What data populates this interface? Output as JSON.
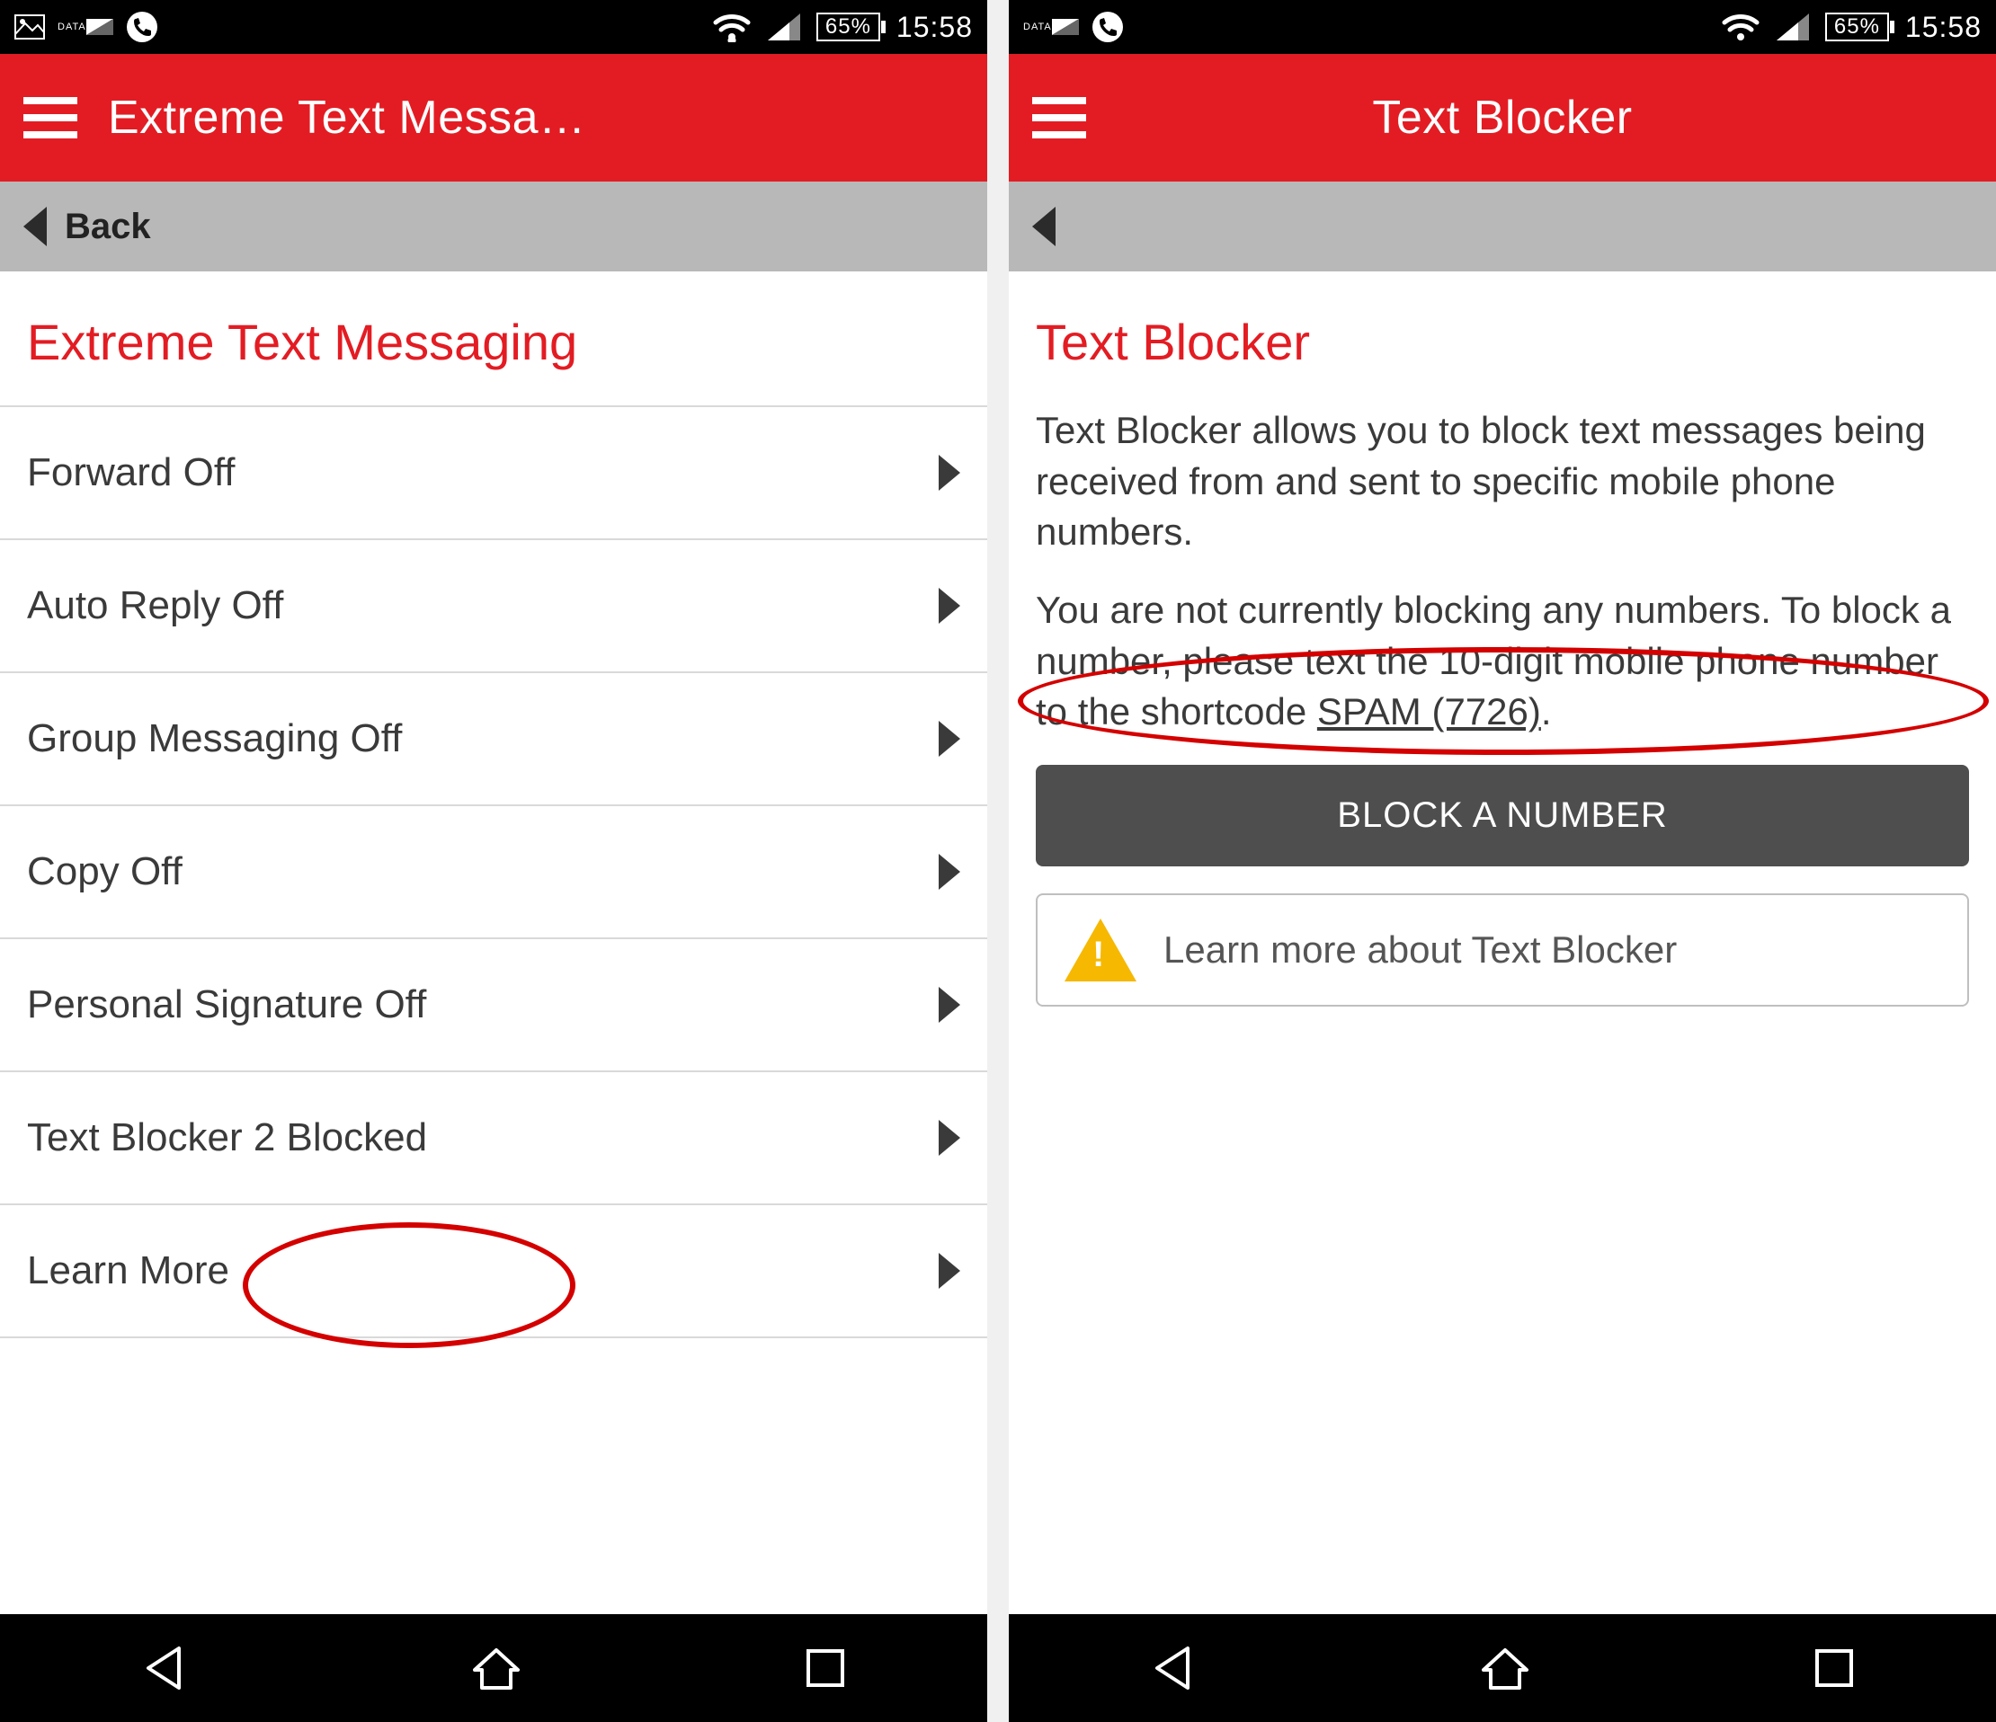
{
  "statusbar": {
    "battery_text": "65%",
    "time": "15:58"
  },
  "left": {
    "appbar_title": "Extreme Text Messa…",
    "back_label": "Back",
    "page_title": "Extreme Text Messaging",
    "items": [
      "Forward Off",
      "Auto Reply Off",
      "Group Messaging Off",
      "Copy Off",
      "Personal Signature Off",
      "Text Blocker 2 Blocked",
      "Learn More"
    ]
  },
  "right": {
    "appbar_title": "Text Blocker",
    "page_title": "Text Blocker",
    "desc1": "Text Blocker allows you to block text messages being received from and sent to specific mobile phone numbers.",
    "desc2a": "You are not currently blocking any numbers. To block a number, please text the 10-digit mobile phone number to the shortcode ",
    "desc2b": "SPAM (7726)",
    "desc2c": ".",
    "block_button": "BLOCK A NUMBER",
    "learn_more": "Learn more about Text Blocker"
  }
}
